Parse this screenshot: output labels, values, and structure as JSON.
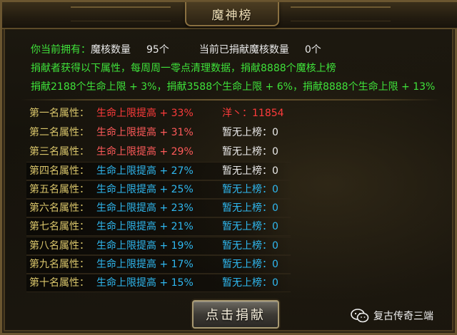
{
  "title": "魔神榜",
  "info": {
    "owned_label": "你当前拥有：",
    "owned_item_label": "魔核数量",
    "owned_count": "95个",
    "donated_label": "当前已捐献魔核数量",
    "donated_count": "0个",
    "rule_line": "捐献者获得以下属性，每周周一零点清理数据，捐献8888个魔核上榜",
    "tier_line": "捐献2188个生命上限 + 3%，捐献3588个生命上限 + 6%，捐献8888个生命上限 + 13%"
  },
  "colors": {
    "green": "#3fe23a",
    "first_place": "#ff3b3b",
    "red_attr": "#ff5a5a",
    "blue_attr": "#2fb8f0",
    "label_gold": "#d9c56a"
  },
  "ranks": [
    {
      "label": "第一名属性：",
      "attr": "生命上限提高 + 33%",
      "holder": "洋丶：11854",
      "attr_color": "#ff3b3b",
      "holder_color": "#ff3b3b"
    },
    {
      "label": "第二名属性：",
      "attr": "生命上限提高 + 31%",
      "holder": "暂无上榜：0",
      "attr_color": "#ff5a5a",
      "holder_color": "#e9e9e9"
    },
    {
      "label": "第三名属性：",
      "attr": "生命上限提高 + 29%",
      "holder": "暂无上榜：0",
      "attr_color": "#ff5a5a",
      "holder_color": "#e9e9e9"
    },
    {
      "label": "第四名属性：",
      "attr": "生命上限提高 + 27%",
      "holder": "暂无上榜：0",
      "attr_color": "#2fb8f0",
      "holder_color": "#e9e9e9"
    },
    {
      "label": "第五名属性：",
      "attr": "生命上限提高 + 25%",
      "holder": "暂无上榜：0",
      "attr_color": "#2fb8f0",
      "holder_color": "#2fb8f0"
    },
    {
      "label": "第六名属性：",
      "attr": "生命上限提高 + 23%",
      "holder": "暂无上榜：0",
      "attr_color": "#2fb8f0",
      "holder_color": "#2fb8f0"
    },
    {
      "label": "第七名属性：",
      "attr": "生命上限提高 + 21%",
      "holder": "暂无上榜：0",
      "attr_color": "#2fb8f0",
      "holder_color": "#2fb8f0"
    },
    {
      "label": "第八名属性：",
      "attr": "生命上限提高 + 19%",
      "holder": "暂无上榜：0",
      "attr_color": "#2fb8f0",
      "holder_color": "#2fb8f0"
    },
    {
      "label": "第九名属性：",
      "attr": "生命上限提高 + 17%",
      "holder": "暂无上榜：0",
      "attr_color": "#2fb8f0",
      "holder_color": "#2fb8f0"
    },
    {
      "label": "第十名属性：",
      "attr": "生命上限提高 + 15%",
      "holder": "暂无上榜：0",
      "attr_color": "#2fb8f0",
      "holder_color": "#2fb8f0"
    }
  ],
  "donate_button": "点击捐献",
  "watermark": {
    "icon": "wechat-icon",
    "text": "复古传奇三端"
  }
}
